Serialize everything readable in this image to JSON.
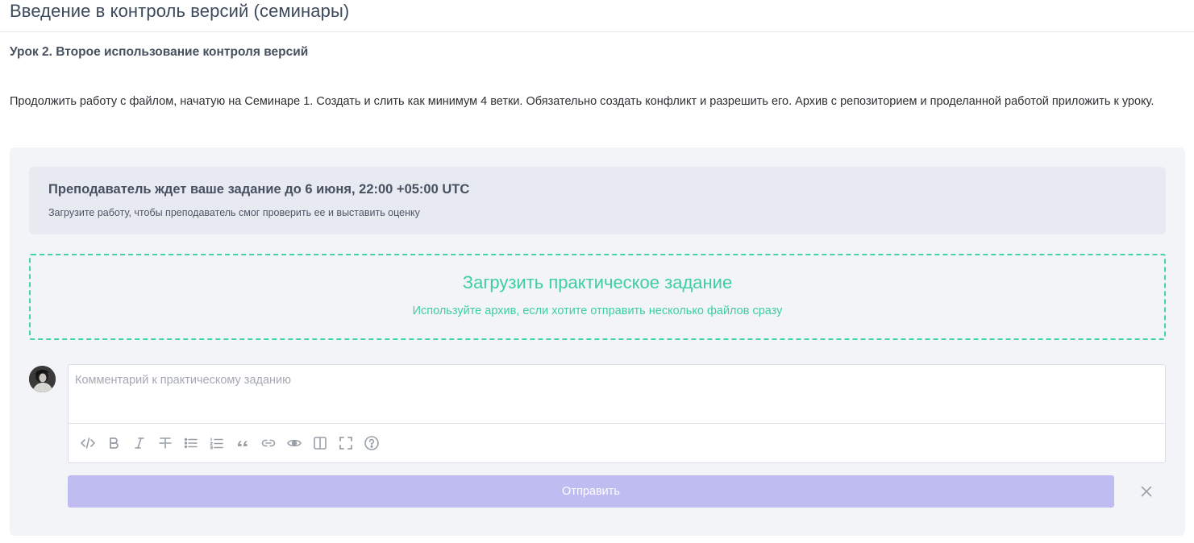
{
  "page": {
    "title": "Введение в контроль версий (семинары)"
  },
  "lesson": {
    "title": "Урок 2. Второе использование контроля версий",
    "description": "Продолжить работу с файлом, начатую на Семинаре 1. Создать и слить как минимум 4 ветки. Обязательно создать конфликт и разрешить его. Архив с репозиторием и проделанной работой приложить к уроку."
  },
  "assignment": {
    "deadline_title": "Преподаватель ждет ваше задание до 6 июня, 22:00 +05:00 UTC",
    "deadline_subtitle": "Загрузите работу, чтобы преподаватель смог проверить ее и выставить оценку",
    "upload_title": "Загрузить практическое задание",
    "upload_subtitle": "Используйте архив, если хотите отправить несколько файлов сразу"
  },
  "comment": {
    "placeholder": "Комментарий к практическому заданию",
    "value": "",
    "toolbar": [
      "code-icon",
      "bold-icon",
      "italic-icon",
      "strikethrough-icon",
      "bullet-list-icon",
      "numbered-list-icon",
      "quote-icon",
      "link-icon",
      "preview-icon",
      "side-by-side-icon",
      "fullscreen-icon",
      "help-icon"
    ]
  },
  "actions": {
    "send_label": "Отправить",
    "close_icon": "close-icon"
  },
  "colors": {
    "accent_green": "#3ecf9e",
    "send_button": "#bfbcf2",
    "panel_bg": "#f3f4f8",
    "deadline_bg": "#e8eaf2"
  }
}
